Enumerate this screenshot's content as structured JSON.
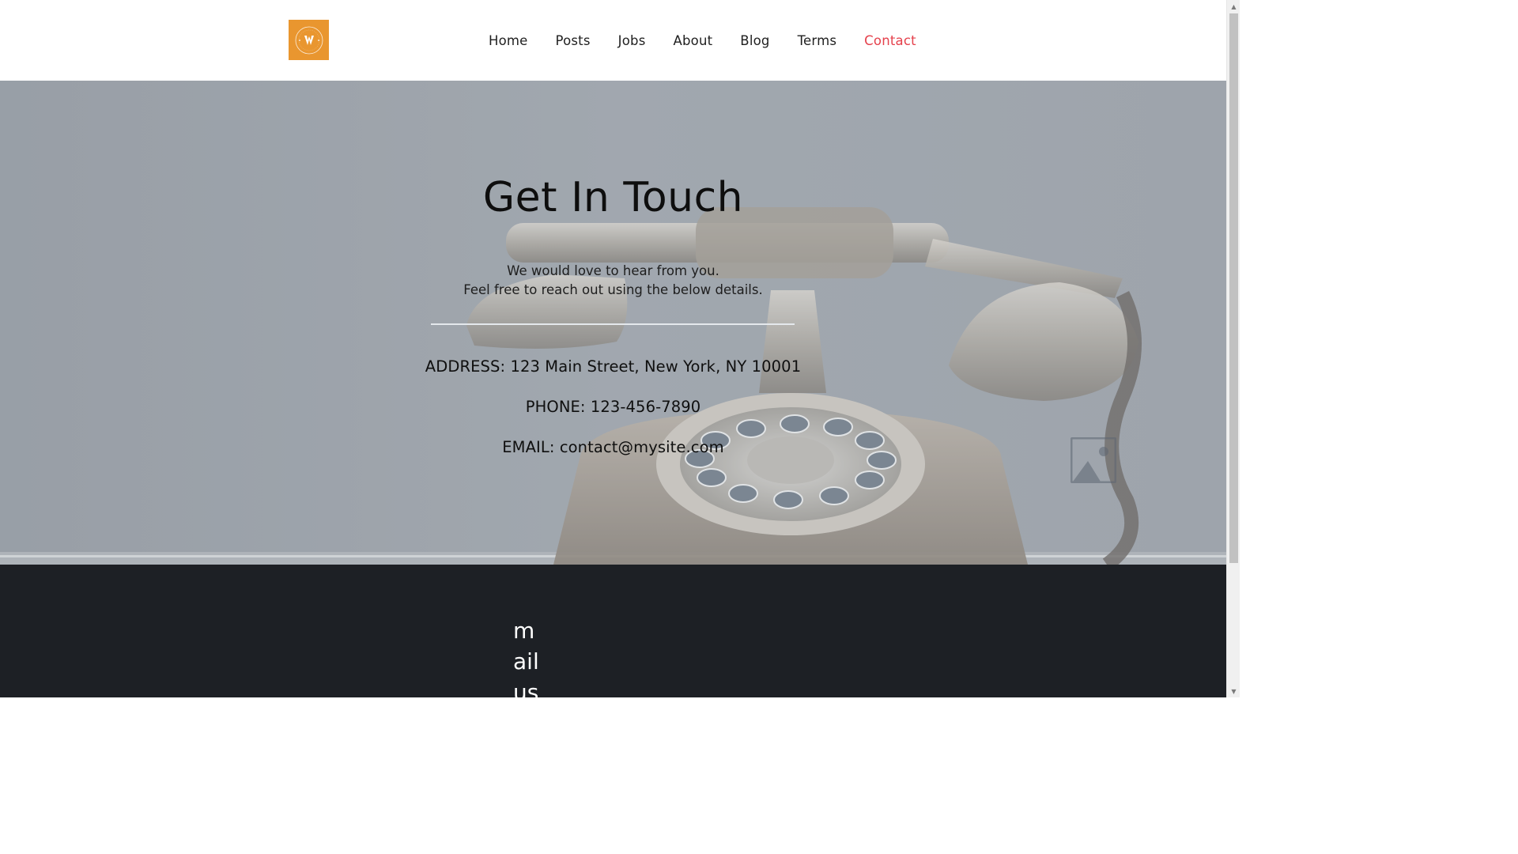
{
  "header": {
    "logo_icon": "brand-logo-icon",
    "logo_color": "#e9962f",
    "nav": [
      {
        "label": "Home",
        "active": false
      },
      {
        "label": "Posts",
        "active": false
      },
      {
        "label": "Jobs",
        "active": false
      },
      {
        "label": "About",
        "active": false
      },
      {
        "label": "Blog",
        "active": false
      },
      {
        "label": "Terms",
        "active": false
      },
      {
        "label": "Contact",
        "active": true
      }
    ],
    "active_color": "#e5414c"
  },
  "hero": {
    "title": "Get In Touch",
    "subtitle_line1": "We would love to hear from you.",
    "subtitle_line2": "Feel free to reach out using the below details.",
    "address": "ADDRESS: 123 Main Street, New York, NY 10001",
    "phone": "PHONE: 123-456-7890",
    "email": "EMAIL: contact@mysite.com",
    "background_icon": "rotary-telephone-image",
    "placeholder_icon": "image-placeholder-icon"
  },
  "footer": {
    "mail_label": "mail us",
    "background": "#1d2025"
  },
  "scrollbar": {
    "up_icon": "scroll-up-arrow-icon",
    "down_icon": "scroll-down-arrow-icon"
  }
}
